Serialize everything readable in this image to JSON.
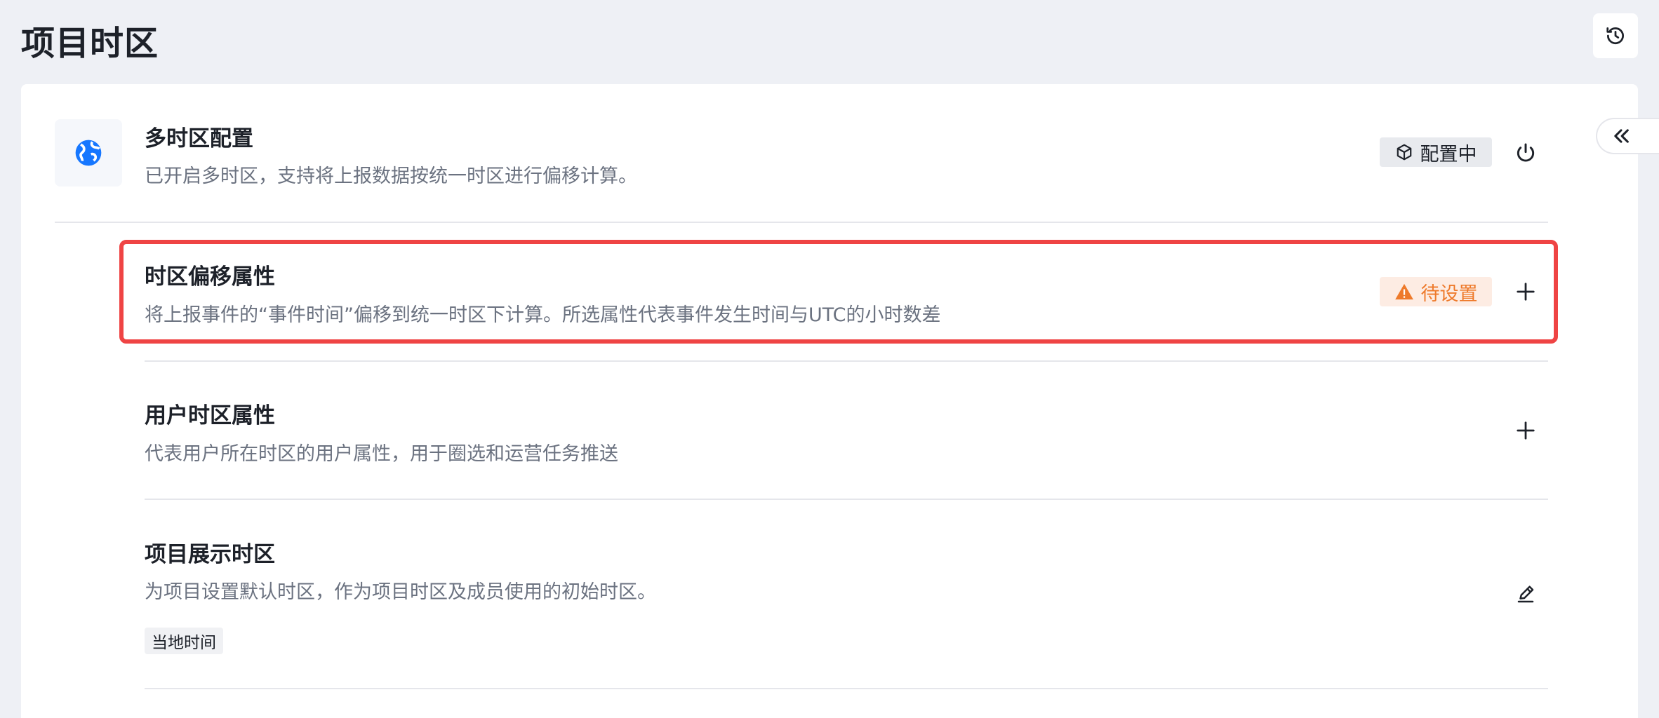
{
  "header": {
    "title": "项目时区",
    "history_icon": "history-icon"
  },
  "multi_timezone": {
    "icon": "globe-icon",
    "title": "多时区配置",
    "description": "已开启多时区，支持将上报数据按统一时区进行偏移计算。",
    "status_icon": "cube-icon",
    "status": "配置中",
    "action_icon": "power-icon"
  },
  "offset_property": {
    "title": "时区偏移属性",
    "description": "将上报事件的“事件时间”偏移到统一时区下计算。所选属性代表事件发生时间与UTC的小时数差",
    "status_icon": "warning-icon",
    "status": "待设置",
    "action_icon": "plus-icon"
  },
  "user_timezone": {
    "title": "用户时区属性",
    "description": "代表用户所在时区的用户属性，用于圈选和运营任务推送",
    "action_icon": "plus-icon"
  },
  "display_timezone": {
    "title": "项目展示时区",
    "description": "为项目设置默认时区，作为项目时区及成员使用的初始时区。",
    "tag": "当地时间",
    "action_icon": "edit-icon"
  },
  "colors": {
    "accent": "#1677ff",
    "warning": "#ee7a2b",
    "highlight": "#ef4444"
  }
}
